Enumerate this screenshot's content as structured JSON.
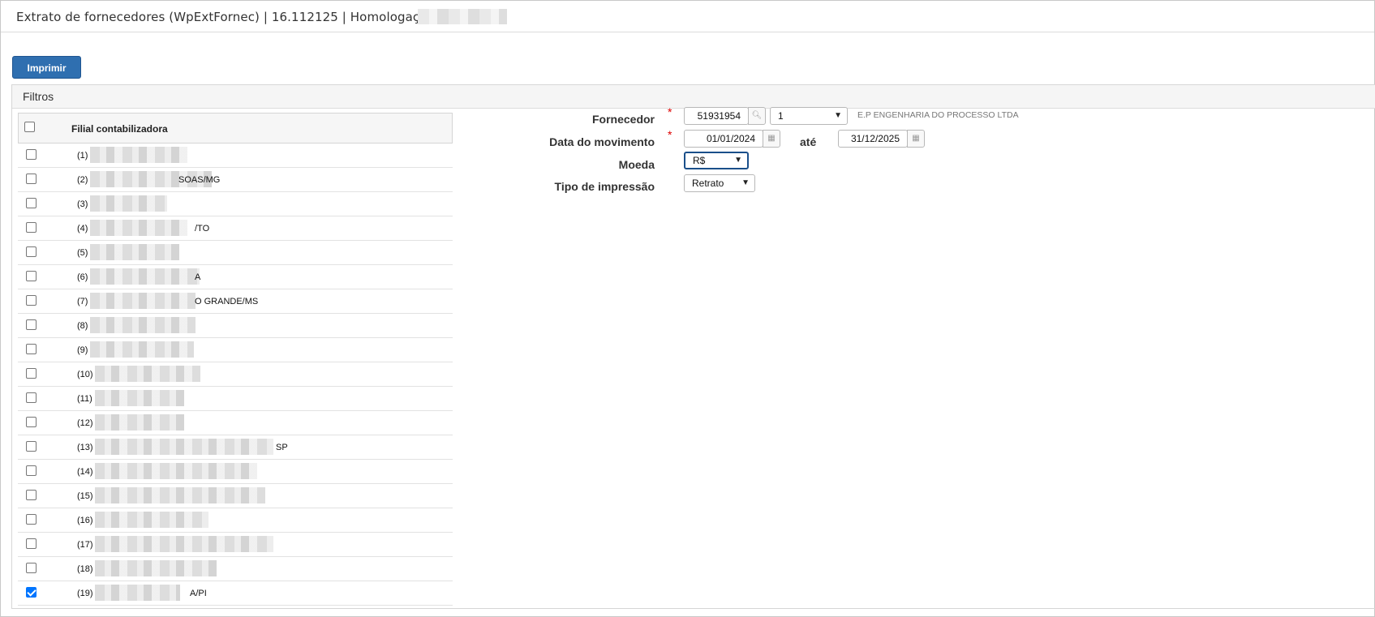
{
  "title": "Extrato de fornecedores (WpExtFornec) | 16.112125 | Homologação |",
  "print_button": "Imprimir",
  "filters_title": "Filtros",
  "grid": {
    "header": "Filial contabilizadora",
    "rows": [
      {
        "num": "(1)",
        "tail": "",
        "checked": false
      },
      {
        "num": "(2)",
        "tail": "SOAS/MG",
        "checked": false
      },
      {
        "num": "(3)",
        "tail": "",
        "checked": false
      },
      {
        "num": "(4)",
        "tail": "/TO",
        "checked": false
      },
      {
        "num": "(5)",
        "tail": "",
        "checked": false
      },
      {
        "num": "(6)",
        "tail": "A",
        "checked": false
      },
      {
        "num": "(7)",
        "tail": "O GRANDE/MS",
        "checked": false
      },
      {
        "num": "(8)",
        "tail": "",
        "checked": false
      },
      {
        "num": "(9)",
        "tail": "",
        "checked": false
      },
      {
        "num": "(10)",
        "tail": "",
        "checked": false
      },
      {
        "num": "(11)",
        "tail": "",
        "checked": false
      },
      {
        "num": "(12)",
        "tail": "",
        "checked": false
      },
      {
        "num": "(13)",
        "tail": "SP",
        "checked": false
      },
      {
        "num": "(14)",
        "tail": "",
        "checked": false
      },
      {
        "num": "(15)",
        "tail": "",
        "checked": false
      },
      {
        "num": "(16)",
        "tail": "",
        "checked": false
      },
      {
        "num": "(17)",
        "tail": "",
        "checked": false
      },
      {
        "num": "(18)",
        "tail": "",
        "checked": false
      },
      {
        "num": "(19)",
        "tail": "A/PI",
        "checked": true
      }
    ]
  },
  "form": {
    "fornecedor_label": "Fornecedor",
    "fornecedor_code": "51931954",
    "fornecedor_option": "1",
    "fornecedor_name": "E.P ENGENHARIA DO PROCESSO LTDA",
    "data_label": "Data do movimento",
    "data_from": "01/01/2024",
    "ate_label": "até",
    "data_to": "31/12/2025",
    "moeda_label": "Moeda",
    "moeda_value": "R$",
    "tipo_label": "Tipo de impressão",
    "tipo_value": "Retrato",
    "required_mark": "*"
  }
}
